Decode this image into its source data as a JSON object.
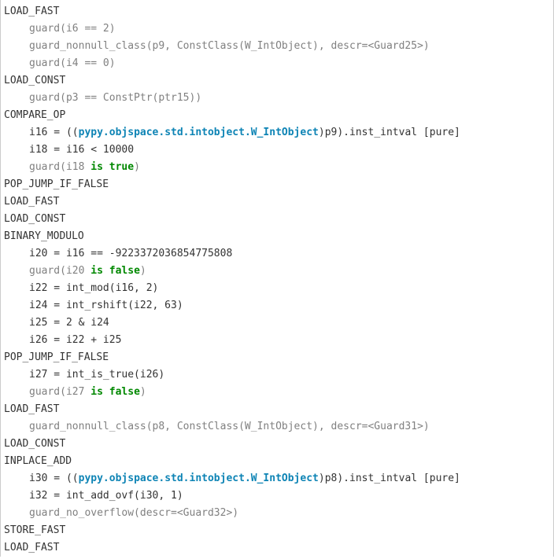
{
  "lines": [
    {
      "type": "bytecode",
      "text": "LOAD_FAST"
    },
    {
      "type": "guard",
      "text": "guard(i6 == 2)"
    },
    {
      "type": "guard",
      "text": "guard_nonnull_class(p9, ConstClass(W_IntObject), descr=<Guard25>)"
    },
    {
      "type": "guard",
      "text": "guard(i4 == 0)"
    },
    {
      "type": "bytecode",
      "text": "LOAD_CONST"
    },
    {
      "type": "guard",
      "text": "guard(p3 == ConstPtr(ptr15))"
    },
    {
      "type": "bytecode",
      "text": "COMPARE_OP"
    },
    {
      "type": "op-cast",
      "prefix": "i16 = ((",
      "dotted": "pypy.objspace.std.intobject.W_IntObject",
      "suffix": ")p9).inst_intval [pure]"
    },
    {
      "type": "op",
      "text": "i18 = i16 < 10000"
    },
    {
      "type": "guard-kw",
      "prefix": "guard(i18 ",
      "kw": "is",
      "mid": " ",
      "kw2": "true",
      "suffix": ")"
    },
    {
      "type": "bytecode",
      "text": "POP_JUMP_IF_FALSE"
    },
    {
      "type": "bytecode",
      "text": "LOAD_FAST"
    },
    {
      "type": "bytecode",
      "text": "LOAD_CONST"
    },
    {
      "type": "bytecode",
      "text": "BINARY_MODULO"
    },
    {
      "type": "op",
      "text": "i20 = i16 == -9223372036854775808"
    },
    {
      "type": "guard-kw",
      "prefix": "guard(i20 ",
      "kw": "is",
      "mid": " ",
      "kw2": "false",
      "suffix": ")"
    },
    {
      "type": "op",
      "text": "i22 = int_mod(i16, 2)"
    },
    {
      "type": "op",
      "text": "i24 = int_rshift(i22, 63)"
    },
    {
      "type": "op",
      "text": "i25 = 2 & i24"
    },
    {
      "type": "op",
      "text": "i26 = i22 + i25"
    },
    {
      "type": "bytecode",
      "text": "POP_JUMP_IF_FALSE"
    },
    {
      "type": "op",
      "text": "i27 = int_is_true(i26)"
    },
    {
      "type": "guard-kw",
      "prefix": "guard(i27 ",
      "kw": "is",
      "mid": " ",
      "kw2": "false",
      "suffix": ")"
    },
    {
      "type": "bytecode",
      "text": "LOAD_FAST"
    },
    {
      "type": "guard",
      "text": "guard_nonnull_class(p8, ConstClass(W_IntObject), descr=<Guard31>)"
    },
    {
      "type": "bytecode",
      "text": "LOAD_CONST"
    },
    {
      "type": "bytecode",
      "text": "INPLACE_ADD"
    },
    {
      "type": "op-cast",
      "prefix": "i30 = ((",
      "dotted": "pypy.objspace.std.intobject.W_IntObject",
      "suffix": ")p8).inst_intval [pure]"
    },
    {
      "type": "op",
      "text": "i32 = int_add_ovf(i30, 1)"
    },
    {
      "type": "guard",
      "text": "guard_no_overflow(descr=<Guard32>)"
    },
    {
      "type": "bytecode",
      "text": "STORE_FAST"
    },
    {
      "type": "bytecode",
      "text": "LOAD_FAST"
    }
  ]
}
